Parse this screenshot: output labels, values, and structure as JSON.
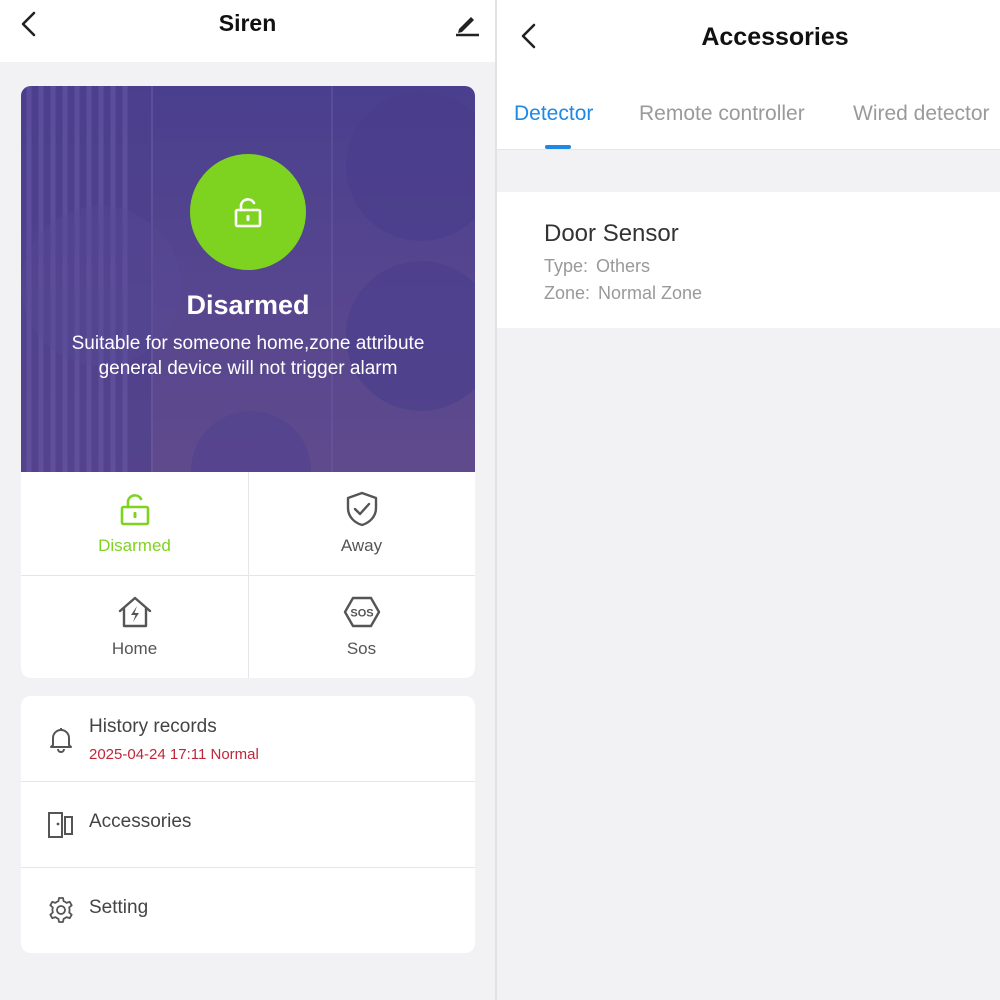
{
  "left": {
    "header": {
      "title": "Siren",
      "back_icon": "chevron-left-icon",
      "edit_icon": "pencil-icon"
    },
    "hero": {
      "status": "Disarmed",
      "description": "Suitable for someone home,zone attribute general device will not trigger alarm",
      "icon": "unlocked-padlock-icon",
      "circle_color": "#7ed321"
    },
    "modes": [
      {
        "label": "Disarmed",
        "icon": "unlocked-padlock-icon",
        "active": true
      },
      {
        "label": "Away",
        "icon": "shield-check-icon",
        "active": false
      },
      {
        "label": "Home",
        "icon": "house-lightning-icon",
        "active": false
      },
      {
        "label": "Sos",
        "icon": "sos-icon",
        "active": false
      }
    ],
    "menu": {
      "history": {
        "label": "History records",
        "subtitle": "2025-04-24 17:11 Normal",
        "icon": "bell-icon"
      },
      "accessories": {
        "label": "Accessories",
        "icon": "door-sensor-icon"
      },
      "setting": {
        "label": "Setting",
        "icon": "gear-icon"
      }
    },
    "colors": {
      "active_green": "#7ed321",
      "history_red": "#c0263a"
    }
  },
  "right": {
    "header": {
      "title": "Accessories",
      "back_icon": "chevron-left-icon"
    },
    "tabs": [
      {
        "label": "Detector",
        "active": true
      },
      {
        "label": "Remote controller",
        "active": false
      },
      {
        "label": "Wired detector",
        "active": false
      }
    ],
    "device": {
      "name": "Door Sensor",
      "type_label": "Type:",
      "type_value": "Others",
      "zone_label": "Zone:",
      "zone_value": "Normal Zone"
    },
    "colors": {
      "accent_blue": "#1f88e5"
    }
  }
}
